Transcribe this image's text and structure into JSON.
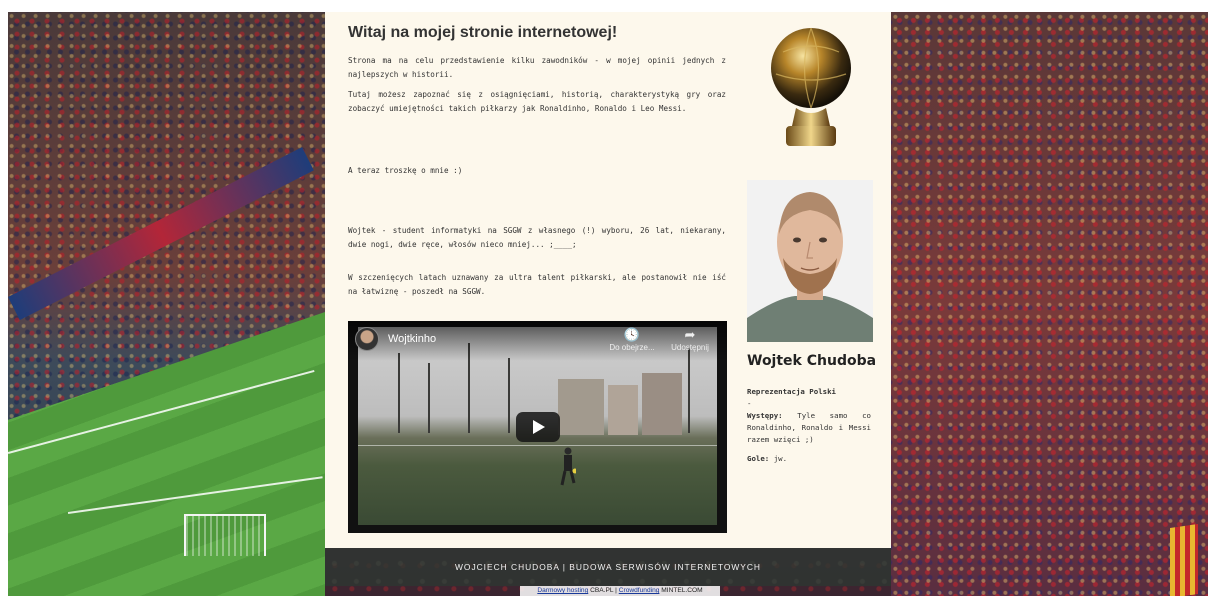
{
  "page": {
    "title": "Witaj na mojej stronie internetowej!",
    "paragraphs": [
      "Strona ma na celu przedstawienie kilku zawodników - w mojej opinii jednych z najlepszych w historii.",
      "Tutaj możesz zapoznać się z osiągnięciami, historią, charakterystyką gry oraz zobaczyć umiejętności takich piłkarzy jak Ronaldinho, Ronaldo i Leo Messi.",
      "A teraz troszkę o mnie :)",
      "Wojtek - student informatyki na SGGW z własnego (!) wyboru, 26 lat, niekarany, dwie nogi, dwie ręce, włosów nieco mniej... ;____;",
      "W szczenięcych latach uznawany za ultra talent piłkarski, ale postanowił nie iść na łatwiznę - poszedł na SGGW."
    ]
  },
  "video": {
    "channel": "Wojtkinho",
    "watch_later": "Do obejrze...",
    "share": "Udostępnij"
  },
  "profile": {
    "name": "Wojtek Chudoba",
    "team": "Reprezentacja Polski",
    "dash": "-",
    "appearances_label": "Występy:",
    "appearances_value": "Tyle samo co Ronaldinho, Ronaldo i Messi razem wzięci ;)",
    "goals_label": "Gole:",
    "goals_value": "jw."
  },
  "footer": {
    "text": "WOJCIECH CHUDOBA | BUDOWA SERWISÓW INTERNETOWYCH"
  },
  "hosting": {
    "link1": "Darmowy hosting",
    "brand": "CBA.PL",
    "sep": "|",
    "link2": "Crowdfunding",
    "brand2": "MINTEL.COM"
  },
  "colors": {
    "panel_bg": "#fdf8ec",
    "text": "#333333",
    "footer_bg": "#2d3732"
  }
}
